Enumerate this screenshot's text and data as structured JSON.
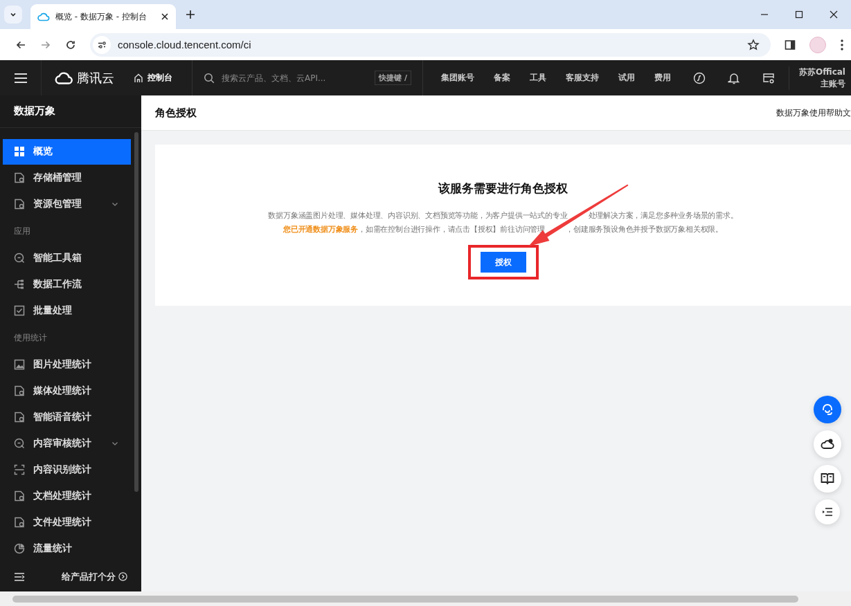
{
  "browser": {
    "tab_title": "概览 - 数据万象 - 控制台",
    "url": "console.cloud.tencent.com/ci"
  },
  "topnav": {
    "brand": "腾讯云",
    "console": "控制台",
    "search_placeholder": "搜索云产品、文档、云API...",
    "shortcut": "快捷键 /",
    "items": [
      "集团账号",
      "备案",
      "工具",
      "客服支持",
      "试用",
      "费用"
    ],
    "user_name": "苏苏Offical",
    "user_role": "主账号"
  },
  "sidebar": {
    "title": "数据万象",
    "items": [
      {
        "kind": "item",
        "label": "概览",
        "selected": true,
        "expandable": false
      },
      {
        "kind": "item",
        "label": "存储桶管理",
        "selected": false,
        "expandable": false
      },
      {
        "kind": "item",
        "label": "资源包管理",
        "selected": false,
        "expandable": true
      },
      {
        "kind": "section",
        "label": "应用"
      },
      {
        "kind": "item",
        "label": "智能工具箱",
        "selected": false,
        "expandable": false
      },
      {
        "kind": "item",
        "label": "数据工作流",
        "selected": false,
        "expandable": false
      },
      {
        "kind": "item",
        "label": "批量处理",
        "selected": false,
        "expandable": false
      },
      {
        "kind": "section",
        "label": "使用统计"
      },
      {
        "kind": "item",
        "label": "图片处理统计",
        "selected": false,
        "expandable": false
      },
      {
        "kind": "item",
        "label": "媒体处理统计",
        "selected": false,
        "expandable": false
      },
      {
        "kind": "item",
        "label": "智能语音统计",
        "selected": false,
        "expandable": false
      },
      {
        "kind": "item",
        "label": "内容审核统计",
        "selected": false,
        "expandable": true
      },
      {
        "kind": "item",
        "label": "内容识别统计",
        "selected": false,
        "expandable": false
      },
      {
        "kind": "item",
        "label": "文档处理统计",
        "selected": false,
        "expandable": false
      },
      {
        "kind": "item",
        "label": "文件处理统计",
        "selected": false,
        "expandable": false
      },
      {
        "kind": "item",
        "label": "流量统计",
        "selected": false,
        "expandable": false
      }
    ],
    "footer": "给产品打个分"
  },
  "page": {
    "title": "角色授权",
    "help_link": "数据万象使用帮助文"
  },
  "card": {
    "heading": "该服务需要进行角色授权",
    "description_before_arrow": "数据万象涵盖图片处理、媒体处理、内容识别、文档预览等功能，为客户提供一站式的专业",
    "description_after_arrow": "处理解决方案，满足您多种业务场景的需求。",
    "notice_highlight": "您已开通数据万象服务",
    "notice_before_arrow": "，如需在控制台进行操作，请点击【授权】前往访问管理",
    "notice_after_arrow": "，创建服务预设角色并授予数据万象相关权限。",
    "button": "授权"
  }
}
